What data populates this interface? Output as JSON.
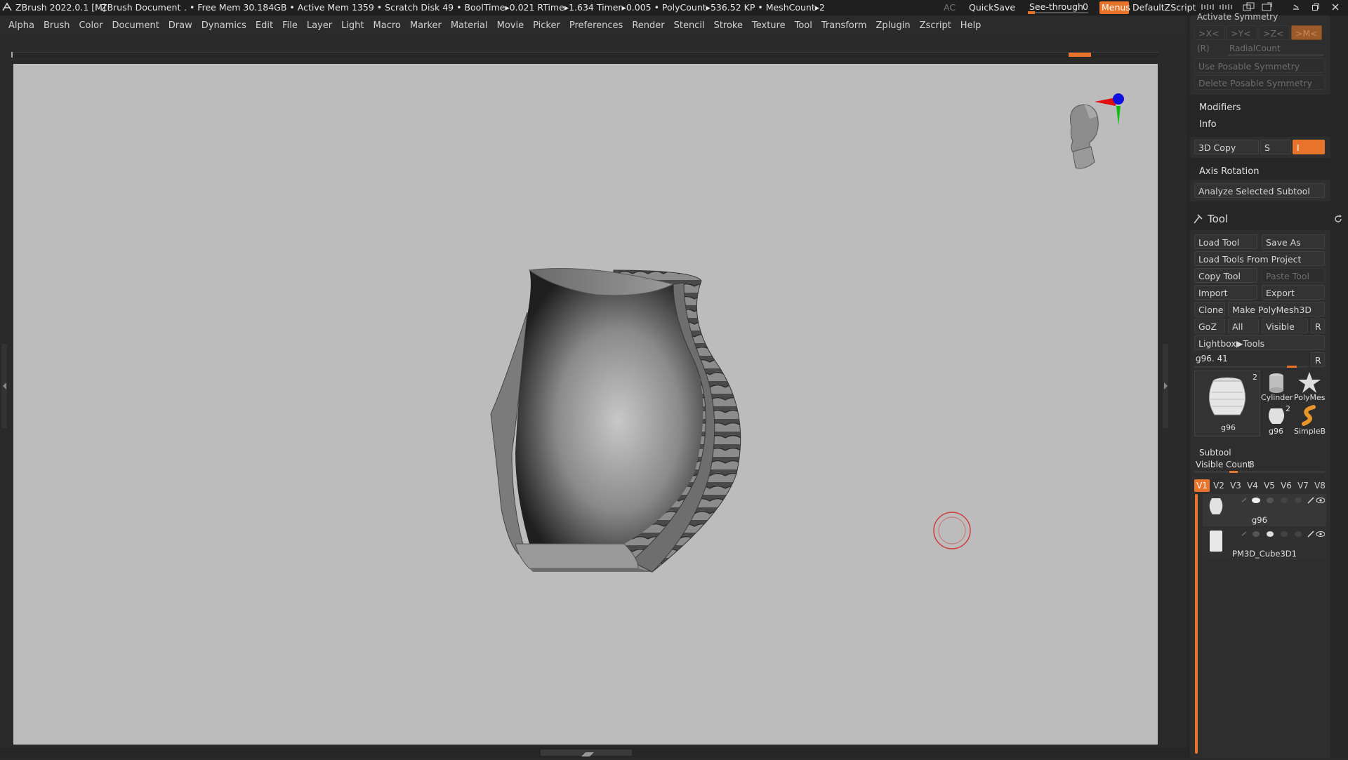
{
  "titlebar": {
    "app": "ZBrush 2022.0.1 [M]",
    "document": "ZBrush Document",
    "stats": ". • Free Mem 30.184GB • Active Mem 1359 • Scratch Disk 49 •  BoolTime▸0.021 RTime▸1.634 Timer▸0.005 • PolyCount▸536.52 KP  • MeshCount▸2",
    "ac": "AC",
    "quicksave": "QuickSave",
    "see_through_label": "See-through",
    "see_through_value": "0",
    "see_through_fraction": 0.0,
    "menus": "Menus",
    "default_zscript": "DefaultZScript"
  },
  "menubar": [
    "Alpha",
    "Brush",
    "Color",
    "Document",
    "Draw",
    "Dynamics",
    "Edit",
    "File",
    "Layer",
    "Light",
    "Macro",
    "Marker",
    "Material",
    "Movie",
    "Picker",
    "Preferences",
    "Render",
    "Stencil",
    "Stroke",
    "Texture",
    "Tool",
    "Transform",
    "Zplugin",
    "Zscript",
    "Help"
  ],
  "panel": {
    "activate_symmetry": "Activate Symmetry",
    "sym_x": ">X<",
    "sym_y": ">Y<",
    "sym_z": ">Z<",
    "sym_m": ">M<",
    "sym_r": "(R)",
    "radial_count": "RadialCount",
    "use_posable": "Use Posable Symmetry",
    "delete_posable": "Delete Posable Symmetry",
    "modifiers": "Modifiers",
    "info": "Info",
    "copy3d": "3D Copy",
    "s_label": "S",
    "i_label": "I",
    "axis_rotation": "Axis Rotation",
    "analyze": "Analyze Selected Subtool",
    "tool_title": "Tool",
    "load_tool": "Load Tool",
    "save_as": "Save As",
    "load_from_project": "Load Tools From Project",
    "copy_tool": "Copy Tool",
    "paste_tool": "Paste Tool",
    "import": "Import",
    "export": "Export",
    "clone": "Clone",
    "make_polymesh": "Make PolyMesh3D",
    "goz": "GoZ",
    "all": "All",
    "visible": "Visible",
    "r": "R",
    "lightbox_tools": "Lightbox▶Tools",
    "current_tool": "g96. 41",
    "r2": "R",
    "thumbs": {
      "main_name": "g96",
      "main_count": "2",
      "cylinder": "Cylinder",
      "polymesh": "PolyMes",
      "g96_small": "g96",
      "g96_small_count": "2",
      "simpleb": "SimpleB"
    },
    "subtool": "Subtool",
    "visible_count_label": "Visible Count",
    "visible_count_value": "8",
    "vtabs": [
      "V1",
      "V2",
      "V3",
      "V4",
      "V5",
      "V6",
      "V7",
      "V8"
    ],
    "subtools": [
      {
        "name": "g96"
      },
      {
        "name": "PM3D_Cube3D1"
      }
    ]
  },
  "colors": {
    "accent": "#e8732a",
    "canvas": "#bcbcbc",
    "panel": "#262626",
    "gizmo_x": "#e01010",
    "gizmo_y": "#10c010",
    "gizmo_z": "#1010e0",
    "cursor": "#d33b3b"
  }
}
